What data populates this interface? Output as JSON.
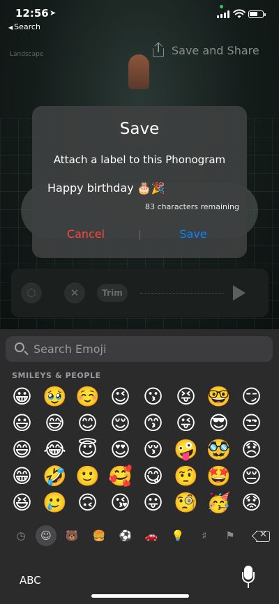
{
  "status_bar": {
    "time": "12:56",
    "back_label": "Search"
  },
  "background": {
    "corner_label": "Landscape"
  },
  "share": {
    "label": "Save and Share"
  },
  "dialog": {
    "title": "Save",
    "message": "Attach a label to this Phonogram",
    "field_value": "Happy birthday 🎂🎉",
    "remaining": "83 characters remaining",
    "cancel_label": "Cancel",
    "save_label": "Save"
  },
  "toolbar": {
    "trim_label": "Trim"
  },
  "keyboard": {
    "search_placeholder": "Search Emoji",
    "section_title": "SMILEYS & PEOPLE",
    "emoji_rows": [
      [
        "😀",
        "🥹",
        "☺️",
        "😉",
        "😗",
        "😝",
        "🤓",
        "😏"
      ],
      [
        "😃",
        "😅",
        "😊",
        "😌",
        "😙",
        "😜",
        "😎",
        "😒"
      ],
      [
        "😄",
        "😂",
        "😇",
        "😍",
        "😚",
        "🤪",
        "🥸",
        "😞"
      ],
      [
        "😁",
        "🤣",
        "🙂",
        "🥰",
        "😋",
        "🤨",
        "🤩",
        "😔"
      ],
      [
        "😆",
        "🥲",
        "🙃",
        "😘",
        "😛",
        "🧐",
        "🥳",
        "😟"
      ]
    ],
    "categories": [
      "recent-icon",
      "smiley-icon",
      "animal-icon",
      "food-icon",
      "ball-icon",
      "car-icon",
      "lightbulb-icon",
      "symbols-icon",
      "flag-icon"
    ],
    "abc_label": "ABC"
  },
  "colors": {
    "destructive": "#ff453a",
    "accent": "#0a84ff",
    "keyboard_bg": "#2b2b2b",
    "dialog_bg": "#3e4040"
  }
}
